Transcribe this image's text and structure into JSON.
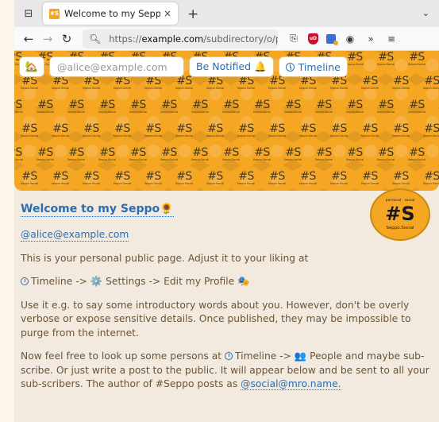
{
  "browser": {
    "tab_title": "Welcome to my Seppo🌻",
    "favicon_label": "#S",
    "tab_close": "×",
    "new_tab": "+",
    "tab_overflow": "⌄",
    "tab_list": "⊟",
    "url_scheme": "https://",
    "url_host": "example.com",
    "url_path": "/subdirectory/o/p/",
    "nav_back": "←",
    "nav_forward": "→",
    "nav_reload": "↻",
    "search_glyph": "🔍︎",
    "extensions_more": "»",
    "menu": "≡",
    "share_glyph": "⎘",
    "ublock_label": "uD",
    "reader_glyph": "◉"
  },
  "banner": {
    "home_glyph": "🏡",
    "email_placeholder": "@alice@example.com",
    "notify_label": "Be Notified 🔔",
    "timeline_label": "Timeline",
    "tile_mark": "#S",
    "tile_caption": "Seppo.Social"
  },
  "logo": {
    "top": "personal · social",
    "mark": "#S",
    "sub": "Seppo.Social"
  },
  "content": {
    "title": "Welcome to my Seppo🌻",
    "handle": "@alice@example.com",
    "p1": "This is your personal public page. Adjust it to your liking at",
    "p2_timeline": "Timeline ->",
    "p2_gear": "⚙️",
    "p2_settings": "Settings -> Edit my Profile",
    "p2_masks": "🎭",
    "p3": "Use it e.g. to say some introductory words about you. However, don't be overly verbose or expose sensitive details. Once published, they may be impossible to purge from the internet.",
    "p4_start": "Now feel free to look up some persons at",
    "p4_timeline": "Timeline ->",
    "p4_people_icon": "👥",
    "p4_rest": "People and maybe sub-scribe. Or just write a post to the public. It will appear below and be sent to all your sub-scribers. The author of #Seppo posts as",
    "p4_mention": "@social@mro.name."
  },
  "colors": {
    "accent": "#2a6db0",
    "banner": "#f5a623",
    "text": "#6a5436",
    "page_bg": "#f3eadf"
  }
}
